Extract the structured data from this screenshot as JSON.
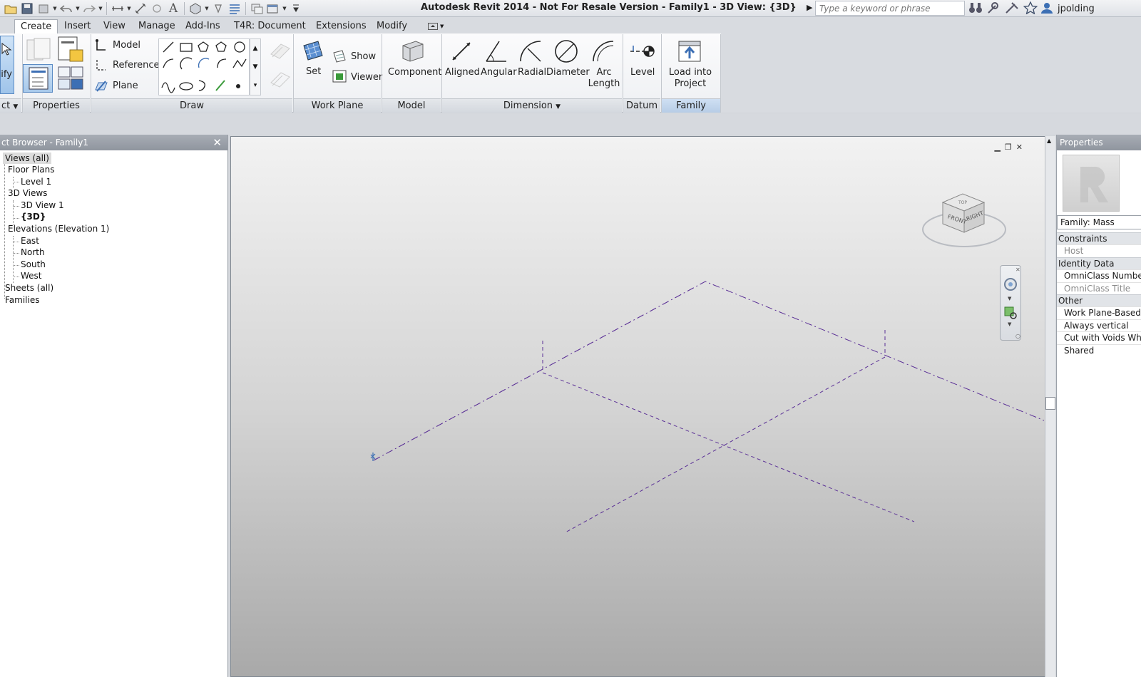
{
  "titlebar": {
    "app_title": "Autodesk Revit 2014 - Not For Resale Version -     Family1 - 3D View: {3D}",
    "search_placeholder": "Type a keyword or phrase",
    "user_name": "jpolding"
  },
  "tabs": [
    {
      "label": "Create",
      "active": true
    },
    {
      "label": "Insert"
    },
    {
      "label": "View"
    },
    {
      "label": "Manage"
    },
    {
      "label": "Add-Ins"
    },
    {
      "label": "T4R: Document"
    },
    {
      "label": "Extensions"
    },
    {
      "label": "Modify"
    }
  ],
  "ribbon": {
    "modify_label": "dify",
    "select_label": "ct",
    "datum_model": "Model",
    "datum_reference": "Reference",
    "datum_plane": "Plane",
    "workplane_set": "Set",
    "workplane_show": "Show",
    "workplane_viewer": "Viewer",
    "component": "Component",
    "aligned": "Aligned",
    "angular": "Angular",
    "radial": "Radial",
    "diameter": "Diameter",
    "arc_length": "Arc Length",
    "level": "Level",
    "load_into_project": "Load into Project",
    "panels": {
      "properties": "Properties",
      "draw": "Draw",
      "work_plane": "Work Plane",
      "model": "Model",
      "dimension": "Dimension",
      "datum": "Datum",
      "family_editor": "Family Editor"
    }
  },
  "browser": {
    "title": "ct Browser - Family1",
    "tree": [
      {
        "label": "Views (all)",
        "selected": true
      },
      {
        "label": "Floor Plans"
      },
      {
        "label": "Level 1"
      },
      {
        "label": "3D Views"
      },
      {
        "label": "3D View 1"
      },
      {
        "label": "{3D}",
        "bold": true
      },
      {
        "label": "Elevations (Elevation 1)"
      },
      {
        "label": "East"
      },
      {
        "label": "North"
      },
      {
        "label": "South"
      },
      {
        "label": "West"
      },
      {
        "label": "Sheets (all)"
      },
      {
        "label": "Families"
      }
    ]
  },
  "viewcube": {
    "front": "FRONT",
    "right": "RIGHT",
    "top": "TOP"
  },
  "properties": {
    "title": "Properties",
    "family_type": "Family: Mass",
    "rows": [
      {
        "label": "Constraints",
        "group": true
      },
      {
        "label": "Host",
        "grey": true
      },
      {
        "label": "Identity Data",
        "group": true
      },
      {
        "label": "OmniClass Number"
      },
      {
        "label": "OmniClass Title",
        "grey": true
      },
      {
        "label": "Other",
        "group": true
      },
      {
        "label": "Work Plane-Based"
      },
      {
        "label": "Always vertical"
      },
      {
        "label": "Cut with Voids Whe"
      },
      {
        "label": "Shared"
      }
    ]
  },
  "colors": {
    "accent": "#3c6fb4",
    "reference_plane": "#5a2f96",
    "tab_bar": "#d8dbe0"
  }
}
